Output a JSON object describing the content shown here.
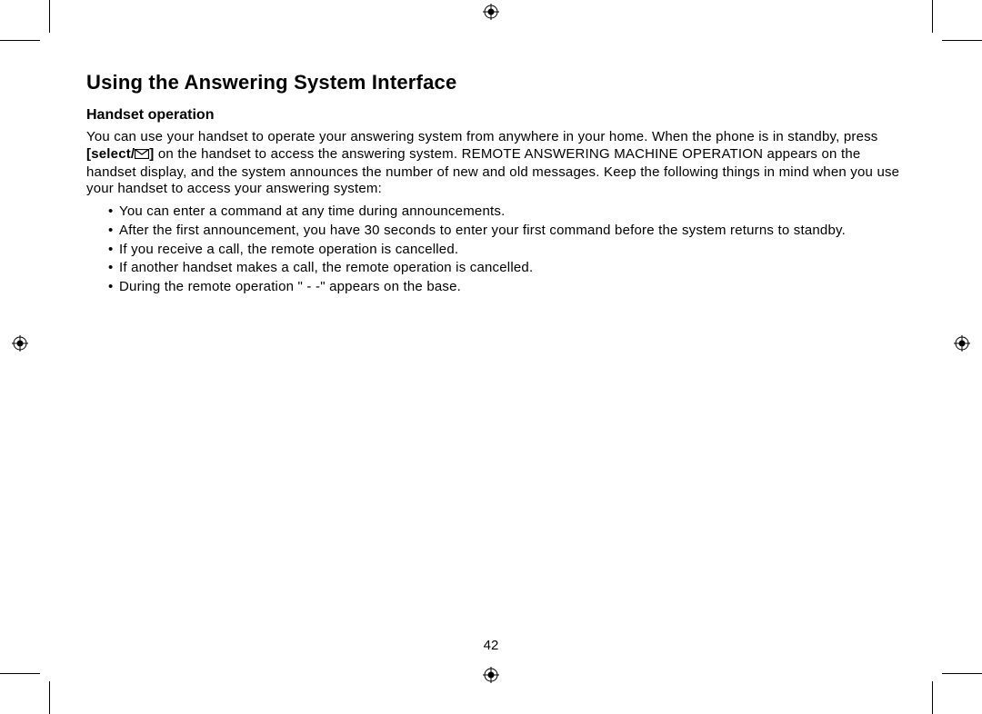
{
  "title": "Using the Answering System Interface",
  "subtitle": "Handset operation",
  "para_before": "You can use your handset to operate your answering system from anywhere in your home. When the phone is in standby, press ",
  "select_label": "[select/",
  "select_suffix": "]",
  "para_after": " on the handset to access the answering system. REMOTE ANSWERING MACHINE OPERATION appears on the handset display, and the system announces the number of new and old messages. Keep the following things in mind when you use your handset to access your answering system:",
  "bullets": [
    "You can enter a command at any time during announcements.",
    "After the first announcement, you have 30 seconds to enter your first command before the system returns to standby.",
    "If you receive a call, the remote operation is cancelled.",
    "If another handset makes a call, the remote operation is cancelled.",
    "During the remote operation \" - -\" appears on the base."
  ],
  "page_number": "42"
}
